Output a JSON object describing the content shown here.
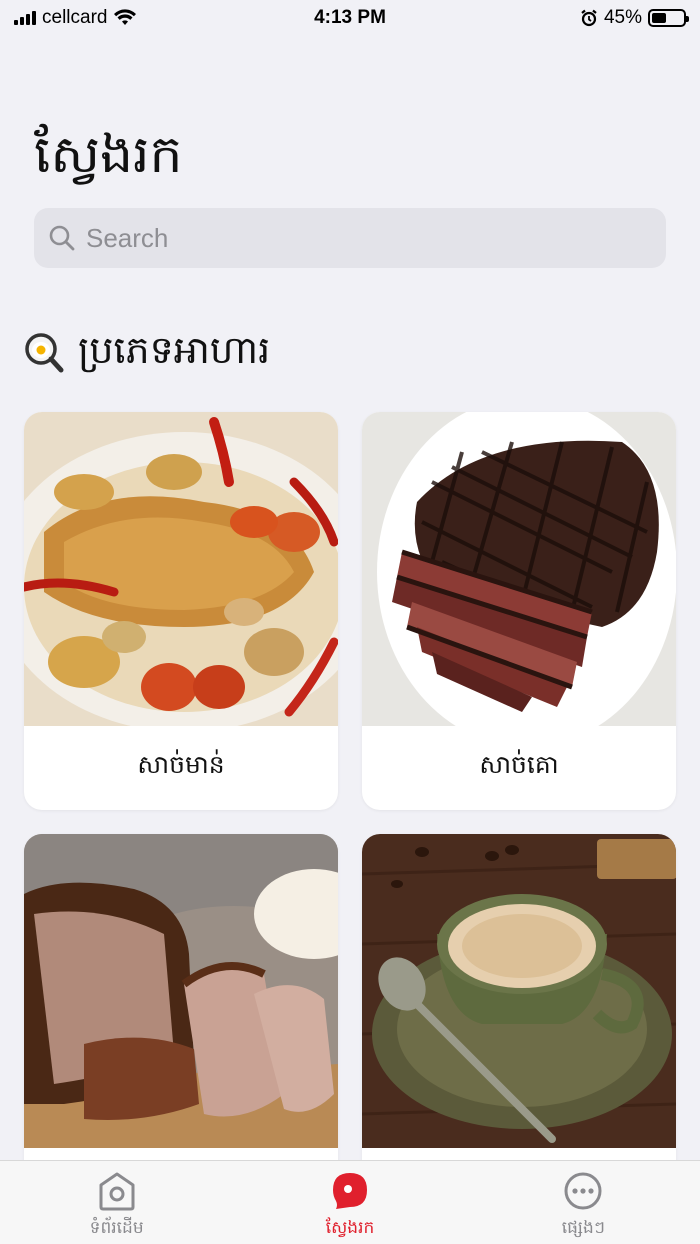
{
  "status_bar": {
    "carrier": "cellcard",
    "time": "4:13 PM",
    "battery_percent": "45%",
    "battery_level": 0.45
  },
  "page": {
    "title": "ស្វែងរក"
  },
  "search": {
    "placeholder": "Search"
  },
  "section": {
    "icon": "magnifier-egg-icon",
    "title": "ប្រភេទអាហារ"
  },
  "categories": [
    {
      "label": "សាច់មាន់",
      "image": "roast-chicken"
    },
    {
      "label": "សាច់គោ",
      "image": "grilled-beef"
    },
    {
      "label": "",
      "image": "roast-pork"
    },
    {
      "label": "",
      "image": "coffee-cup"
    }
  ],
  "tab_bar": {
    "tabs": [
      {
        "label": "ទំព័រដើម",
        "icon": "home-icon",
        "active": false
      },
      {
        "label": "ស្វែងរក",
        "icon": "search-bubble-icon",
        "active": true
      },
      {
        "label": "ផ្សេងៗ",
        "icon": "more-icon",
        "active": false
      }
    ]
  },
  "colors": {
    "accent": "#e0202d",
    "background": "#f1f1f6",
    "inactive": "#8a8a8e"
  }
}
